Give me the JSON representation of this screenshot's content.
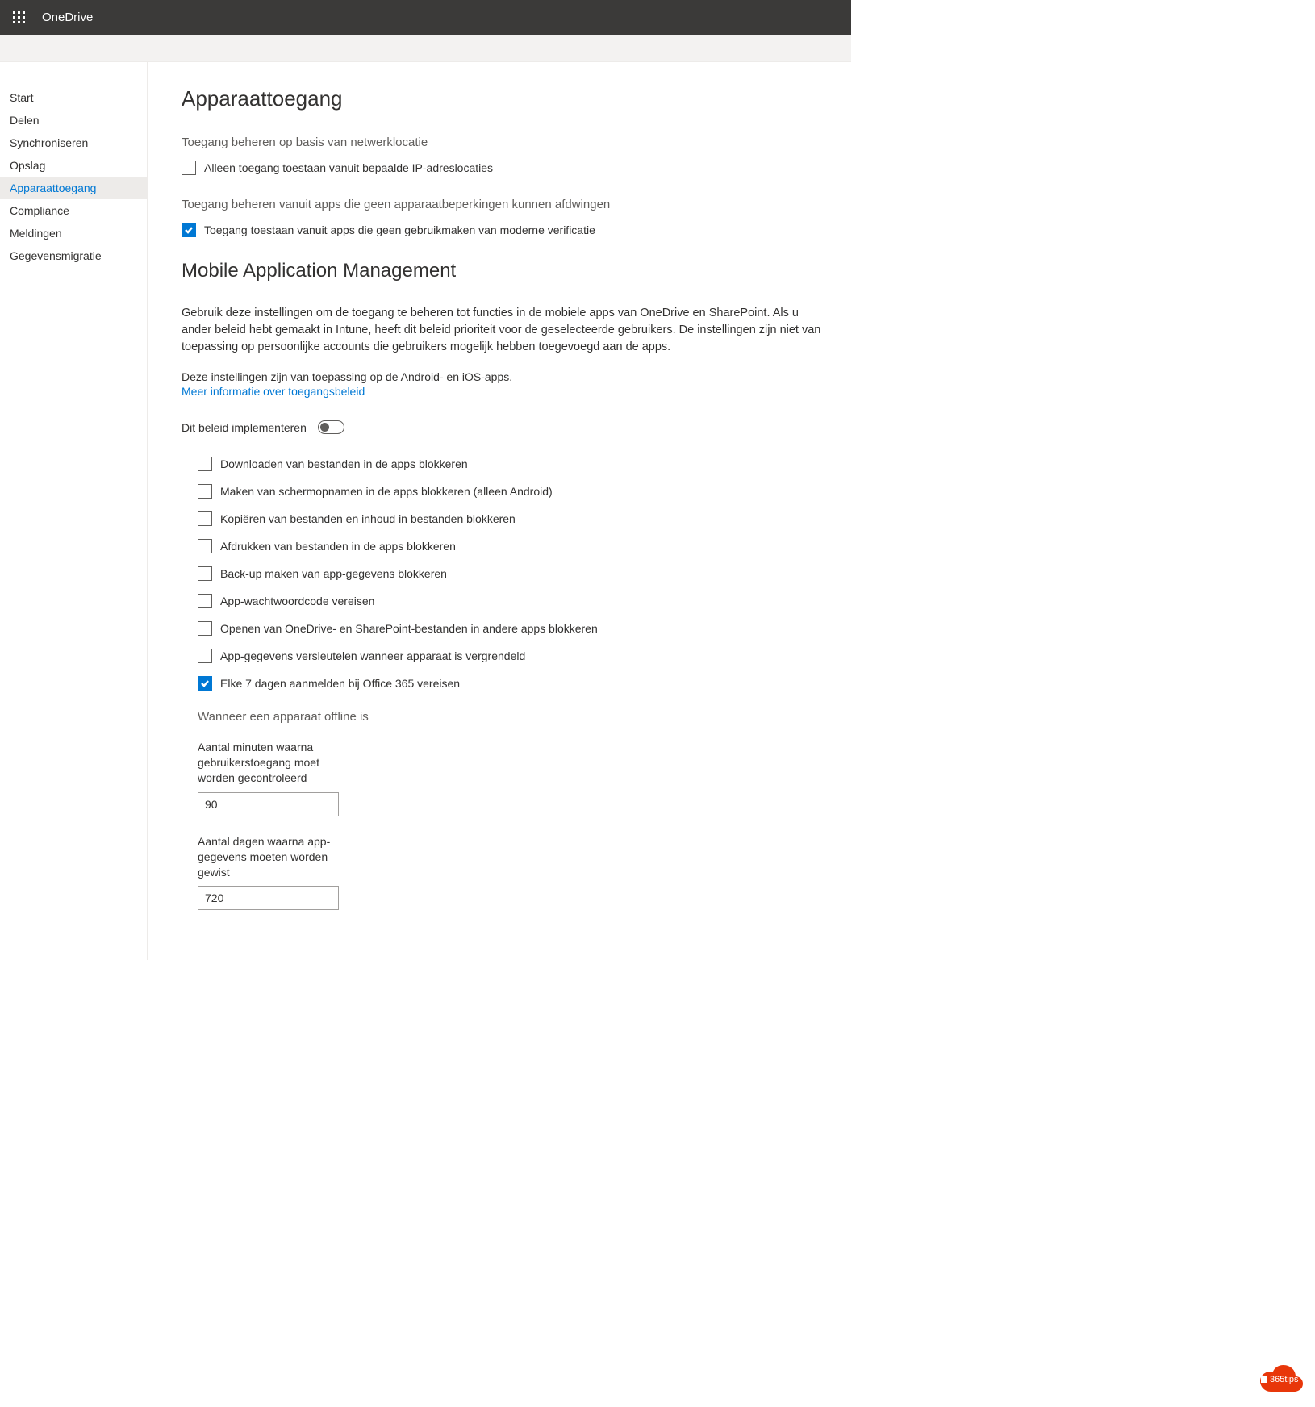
{
  "header": {
    "app_name": "OneDrive"
  },
  "sidebar": {
    "items": [
      {
        "label": "Start"
      },
      {
        "label": "Delen"
      },
      {
        "label": "Synchroniseren"
      },
      {
        "label": "Opslag"
      },
      {
        "label": "Apparaattoegang"
      },
      {
        "label": "Compliance"
      },
      {
        "label": "Meldingen"
      },
      {
        "label": "Gegevensmigratie"
      }
    ],
    "active_index": 4
  },
  "main": {
    "title": "Apparaattoegang",
    "section_network_label": "Toegang beheren op basis van netwerklocatie",
    "check_ip_label": "Alleen toegang toestaan vanuit bepaalde IP-adreslocaties",
    "section_apps_label": "Toegang beheren vanuit apps die geen apparaatbeperkingen kunnen afdwingen",
    "check_modern_auth_label": "Toegang toestaan vanuit apps die geen gebruikmaken van moderne verificatie",
    "mam_title": "Mobile Application Management",
    "mam_desc": "Gebruik deze instellingen om de toegang te beheren tot functies in de mobiele apps van OneDrive en SharePoint. Als u ander beleid hebt gemaakt in Intune, heeft dit beleid prioriteit voor de geselecteerde gebruikers. De instellingen zijn niet van toepassing op persoonlijke accounts die gebruikers mogelijk hebben toegevoegd aan de apps.",
    "mam_note": "Deze instellingen zijn van toepassing op de Android- en iOS-apps.",
    "mam_link": "Meer informatie over toegangsbeleid",
    "toggle_label": "Dit beleid implementeren",
    "policies": [
      {
        "label": "Downloaden van bestanden in de apps blokkeren",
        "checked": false
      },
      {
        "label": "Maken van schermopnamen in de apps blokkeren (alleen Android)",
        "checked": false
      },
      {
        "label": "Kopiëren van bestanden en inhoud in bestanden blokkeren",
        "checked": false
      },
      {
        "label": "Afdrukken van bestanden in de apps blokkeren",
        "checked": false
      },
      {
        "label": "Back-up maken van app-gegevens blokkeren",
        "checked": false
      },
      {
        "label": "App-wachtwoordcode vereisen",
        "checked": false
      },
      {
        "label": "Openen van OneDrive- en SharePoint-bestanden in andere apps blokkeren",
        "checked": false
      },
      {
        "label": "App-gegevens versleutelen wanneer apparaat is vergrendeld",
        "checked": false
      },
      {
        "label": "Elke 7 dagen aanmelden bij Office 365 vereisen",
        "checked": true
      }
    ],
    "offline_heading": "Wanneer een apparaat offline is",
    "field_minutes_label": "Aantal minuten waarna gebruikerstoegang moet worden gecontroleerd",
    "field_minutes_value": "90",
    "field_days_label": "Aantal dagen waarna app-gegevens moeten worden gewist",
    "field_days_value": "720"
  },
  "badge": {
    "text": "365tips"
  }
}
